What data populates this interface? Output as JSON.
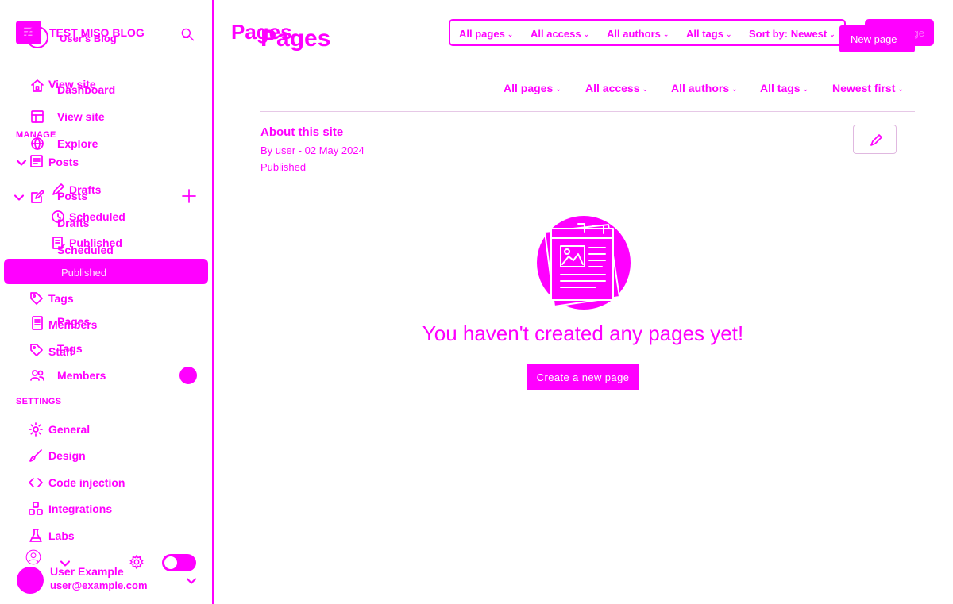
{
  "site": {
    "title": "TEST MISO BLOG",
    "subtitle": "User's Blog"
  },
  "sidebar": {
    "nav_layer_a": {
      "view_site": "View site",
      "manage_label": "MANAGE",
      "posts": "Posts",
      "drafts": "Drafts",
      "scheduled": "Scheduled",
      "published": "Published",
      "pages": "Pages",
      "tags": "Tags"
    },
    "nav_layer_b": {
      "dashboard": "Dashboard",
      "view_site": "View site",
      "explore": "Explore",
      "posts": "Posts",
      "drafts": "Drafts",
      "scheduled": "Scheduled",
      "active_ghost": "Published",
      "tags": "Tags",
      "members": "Members",
      "staff": "Staff",
      "members_2": "Members"
    },
    "settings_label": "SETTINGS",
    "settings": {
      "general": "General",
      "design": "Design",
      "code_injection": "Code injection",
      "integrations": "Integrations",
      "labs": "Labs"
    },
    "user": {
      "name": "User Example",
      "email": "user@example.com"
    }
  },
  "main": {
    "title_a": "Pages",
    "title_b": "Pages",
    "new_page_a": "New page",
    "new_page_b": "New page",
    "top_filters": {
      "pages": "All pages",
      "access": "All access",
      "authors": "All authors",
      "tags": "All tags",
      "sort": "Sort by: Newest"
    },
    "filters": {
      "pages": "All pages",
      "access": "All access",
      "authors": "All authors",
      "tags": "All tags",
      "sort": "Newest first"
    },
    "item": {
      "title": "About this site",
      "byline": "By user - 02 May 2024",
      "status": "Published"
    },
    "empty": {
      "message": "You haven't created any pages yet!",
      "cta": "Create a new page"
    }
  },
  "colors": {
    "accent": "#ff00ff",
    "background": "#ffffff"
  }
}
